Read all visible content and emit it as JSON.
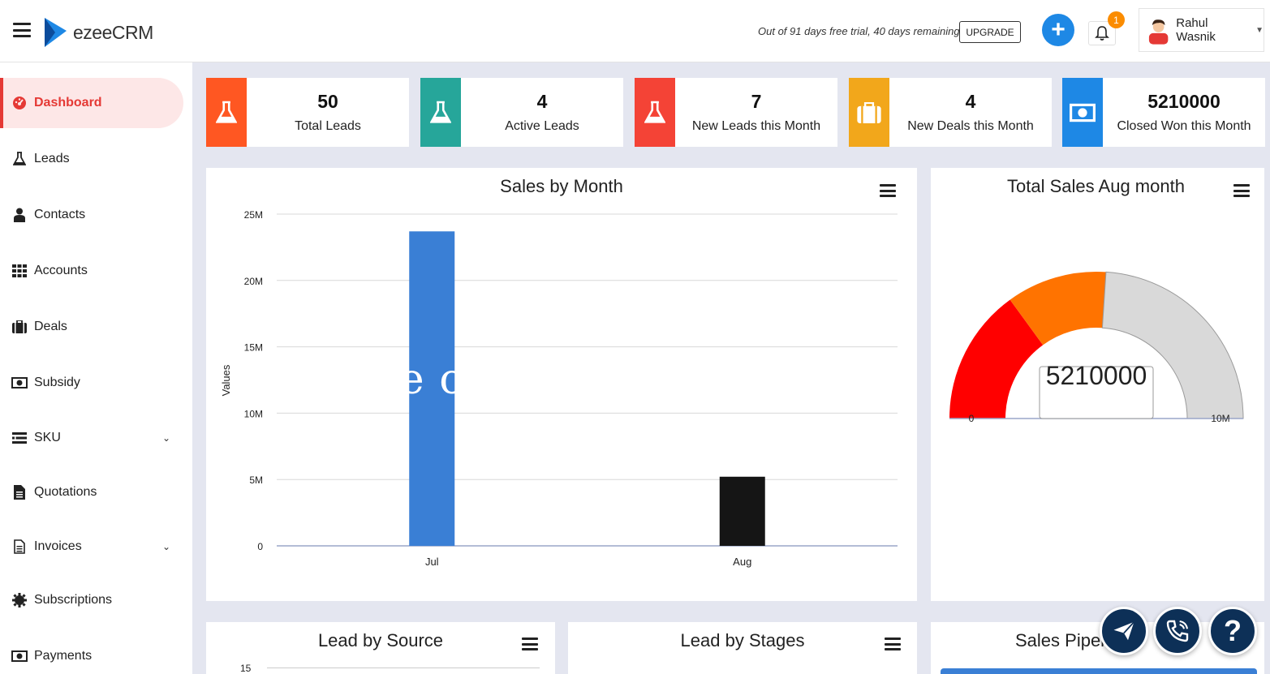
{
  "header": {
    "logo_text": "ezeeCRM",
    "trial_text": "Out of 91 days free trial, 40 days remaining",
    "upgrade_label": "UPGRADE",
    "add_label": "+",
    "notification_count": "1",
    "user_name": "Rahul Wasnik"
  },
  "sidebar": {
    "items": [
      {
        "label": "Dashboard",
        "icon": "dashboard-icon",
        "active": true
      },
      {
        "label": "Leads",
        "icon": "flask-icon"
      },
      {
        "label": "Contacts",
        "icon": "user-icon"
      },
      {
        "label": "Accounts",
        "icon": "grid-icon"
      },
      {
        "label": "Deals",
        "icon": "briefcase-icon"
      },
      {
        "label": "Subsidy",
        "icon": "money-icon"
      },
      {
        "label": "SKU",
        "icon": "list-icon",
        "has_submenu": true
      },
      {
        "label": "Quotations",
        "icon": "document-icon"
      },
      {
        "label": "Invoices",
        "icon": "invoice-icon",
        "has_submenu": true
      },
      {
        "label": "Subscriptions",
        "icon": "cog-icon"
      },
      {
        "label": "Payments",
        "icon": "money-icon"
      }
    ]
  },
  "stats": [
    {
      "value": "50",
      "label": "Total Leads",
      "color": "#ff5722",
      "icon": "flask-icon"
    },
    {
      "value": "4",
      "label": "Active Leads",
      "color": "#26a69a",
      "icon": "flask-icon"
    },
    {
      "value": "7",
      "label": "New Leads this Month",
      "color": "#f44336",
      "icon": "flask-icon"
    },
    {
      "value": "4",
      "label": "New Deals this Month",
      "color": "#f2a71b",
      "icon": "briefcase-icon"
    },
    {
      "value": "5210000",
      "label": "Closed Won this Month",
      "color": "#1e88e5",
      "icon": "money-icon"
    }
  ],
  "panels": {
    "sales_by_month": "Sales by Month",
    "total_sales_aug": "Total Sales Aug month",
    "lead_by_source": "Lead by Source",
    "lead_by_stages": "Lead by Stages",
    "sales_pipeline": "Sales Pipeli"
  },
  "watermark": "te                         om",
  "chart_data": [
    {
      "type": "bar",
      "title": "Sales by Month",
      "categories": [
        "Jul",
        "Aug"
      ],
      "values": [
        23700000,
        5210000
      ],
      "colors": [
        "#3a7fd5",
        "#151515"
      ],
      "ylabel": "Values",
      "ylim": [
        0,
        25000000
      ],
      "yticks": [
        "0",
        "5M",
        "10M",
        "15M",
        "20M",
        "25M"
      ],
      "grid": true
    },
    {
      "type": "gauge",
      "title": "Total Sales Aug month",
      "value": 5210000,
      "value_label": "5210000",
      "min": 0,
      "max": 10000000,
      "min_label": "0",
      "max_label": "10M",
      "bands": [
        {
          "from": 0,
          "to": 3000000,
          "color": "#ff0000"
        },
        {
          "from": 3000000,
          "to": 5210000,
          "color": "#ff7300"
        },
        {
          "from": 5210000,
          "to": 10000000,
          "color": "#d9d9d9"
        }
      ]
    },
    {
      "type": "bar",
      "title": "Lead by Source",
      "yticks": [
        "15"
      ]
    }
  ]
}
